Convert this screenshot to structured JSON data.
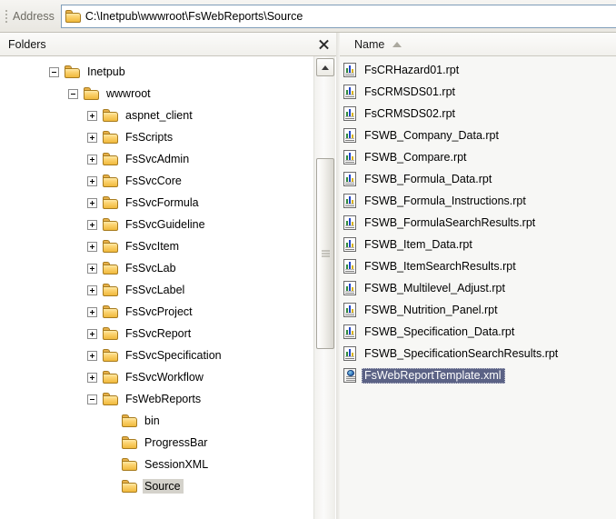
{
  "address_bar": {
    "label": "Address",
    "value": "C:\\Inetpub\\wwwroot\\FsWebReports\\Source",
    "folder_icon": "folder-icon",
    "grip_icon": "drag-grip-icon"
  },
  "folders_pane": {
    "title": "Folders",
    "close_icon": "close-icon",
    "scrollbar": {
      "up_arrow_icon": "scroll-up-arrow-icon",
      "thumb_grip_icon": "scrollbar-grip-icon"
    },
    "tree": [
      {
        "label": "Inetpub",
        "depth": 2,
        "toggle": "minus",
        "selected": false
      },
      {
        "label": "wwwroot",
        "depth": 3,
        "toggle": "minus",
        "selected": false
      },
      {
        "label": "aspnet_client",
        "depth": 4,
        "toggle": "plus",
        "selected": false
      },
      {
        "label": "FsScripts",
        "depth": 4,
        "toggle": "plus",
        "selected": false
      },
      {
        "label": "FsSvcAdmin",
        "depth": 4,
        "toggle": "plus",
        "selected": false
      },
      {
        "label": "FsSvcCore",
        "depth": 4,
        "toggle": "plus",
        "selected": false
      },
      {
        "label": "FsSvcFormula",
        "depth": 4,
        "toggle": "plus",
        "selected": false
      },
      {
        "label": "FsSvcGuideline",
        "depth": 4,
        "toggle": "plus",
        "selected": false
      },
      {
        "label": "FsSvcItem",
        "depth": 4,
        "toggle": "plus",
        "selected": false
      },
      {
        "label": "FsSvcLab",
        "depth": 4,
        "toggle": "plus",
        "selected": false
      },
      {
        "label": "FsSvcLabel",
        "depth": 4,
        "toggle": "plus",
        "selected": false
      },
      {
        "label": "FsSvcProject",
        "depth": 4,
        "toggle": "plus",
        "selected": false
      },
      {
        "label": "FsSvcReport",
        "depth": 4,
        "toggle": "plus",
        "selected": false
      },
      {
        "label": "FsSvcSpecification",
        "depth": 4,
        "toggle": "plus",
        "selected": false
      },
      {
        "label": "FsSvcWorkflow",
        "depth": 4,
        "toggle": "plus",
        "selected": false
      },
      {
        "label": "FsWebReports",
        "depth": 4,
        "toggle": "minus",
        "selected": false
      },
      {
        "label": "bin",
        "depth": 5,
        "toggle": "none",
        "selected": false
      },
      {
        "label": "ProgressBar",
        "depth": 5,
        "toggle": "none",
        "selected": false
      },
      {
        "label": "SessionXML",
        "depth": 5,
        "toggle": "none",
        "selected": false
      },
      {
        "label": "Source",
        "depth": 5,
        "toggle": "none",
        "selected": true
      }
    ]
  },
  "files_pane": {
    "column_header": "Name",
    "sort_icon": "sort-ascending-icon",
    "files": [
      {
        "name": "FsCRHazard01.rpt",
        "icon": "report-file-icon",
        "selected": false
      },
      {
        "name": "FsCRMSDS01.rpt",
        "icon": "report-file-icon",
        "selected": false
      },
      {
        "name": "FsCRMSDS02.rpt",
        "icon": "report-file-icon",
        "selected": false
      },
      {
        "name": "FSWB_Company_Data.rpt",
        "icon": "report-file-icon",
        "selected": false
      },
      {
        "name": "FSWB_Compare.rpt",
        "icon": "report-file-icon",
        "selected": false
      },
      {
        "name": "FSWB_Formula_Data.rpt",
        "icon": "report-file-icon",
        "selected": false
      },
      {
        "name": "FSWB_Formula_Instructions.rpt",
        "icon": "report-file-icon",
        "selected": false
      },
      {
        "name": "FSWB_FormulaSearchResults.rpt",
        "icon": "report-file-icon",
        "selected": false
      },
      {
        "name": "FSWB_Item_Data.rpt",
        "icon": "report-file-icon",
        "selected": false
      },
      {
        "name": "FSWB_ItemSearchResults.rpt",
        "icon": "report-file-icon",
        "selected": false
      },
      {
        "name": "FSWB_Multilevel_Adjust.rpt",
        "icon": "report-file-icon",
        "selected": false
      },
      {
        "name": "FSWB_Nutrition_Panel.rpt",
        "icon": "report-file-icon",
        "selected": false
      },
      {
        "name": "FSWB_Specification_Data.rpt",
        "icon": "report-file-icon",
        "selected": false
      },
      {
        "name": "FSWB_SpecificationSearchResults.rpt",
        "icon": "report-file-icon",
        "selected": false
      },
      {
        "name": "FsWebReportTemplate.xml",
        "icon": "xml-file-icon",
        "selected": true
      }
    ]
  },
  "colors": {
    "selection_file": "#5b6285",
    "selection_tree": "#d4d2cb",
    "address_border": "#7f9db9",
    "folder_yellow": "#fcd472"
  }
}
